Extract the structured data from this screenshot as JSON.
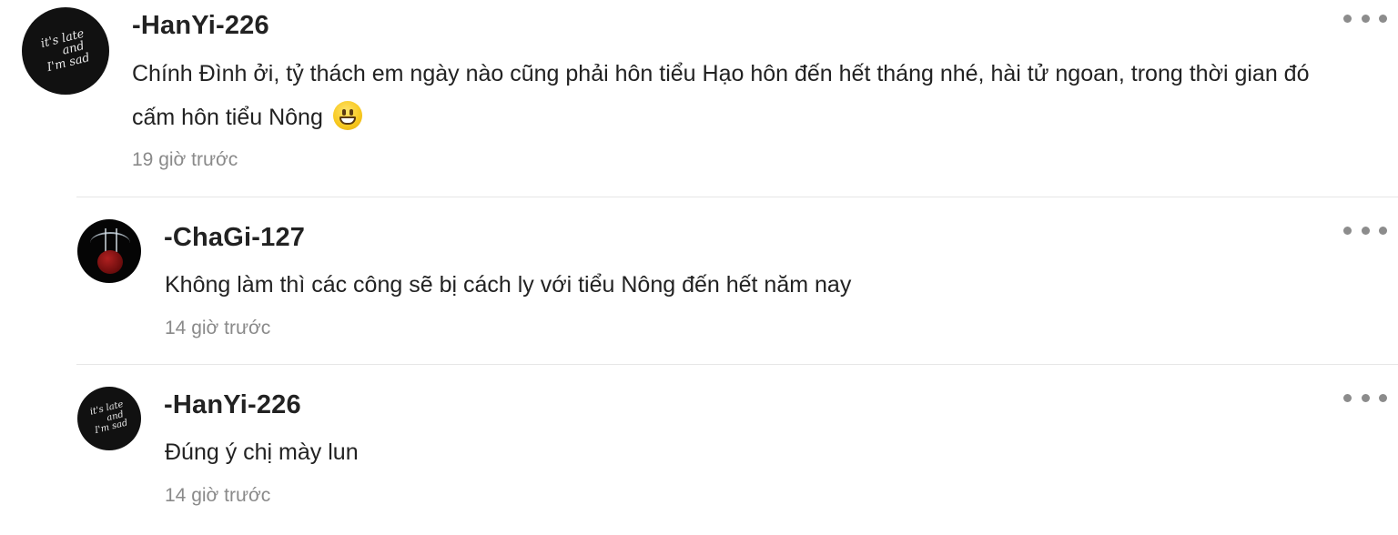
{
  "comments": [
    {
      "username": "-HanYi-226",
      "text_line1": "Chính Đình ởi, tỷ thách em ngày nào cũng phải hôn tiểu Hạo hôn đến hết tháng nhé, hài tử ngoan, trong thời gian đó",
      "text_line2": "cấm hôn tiểu Nông",
      "emoji": "grinning-face-emoji",
      "timestamp": "19 giờ trước",
      "avatar": {
        "lines": [
          "it's late",
          "and",
          "I'm sad"
        ],
        "icon": "chalkboard-avatar"
      }
    },
    {
      "username": "-ChaGi-127",
      "text": "Không làm thì các công sẽ bị cách ly với tiểu Nông đến hết năm nay",
      "timestamp": "14 giờ trước",
      "avatar": {
        "icon": "apple-splash-avatar"
      }
    },
    {
      "username": "-HanYi-226",
      "text": "Đúng ý chị mày lun",
      "timestamp": "14 giờ trước",
      "avatar": {
        "lines": [
          "it's late",
          "and",
          "I'm sad"
        ],
        "icon": "chalkboard-avatar"
      }
    }
  ],
  "more_icon": "more-horizontal-icon",
  "colors": {
    "text": "#222222",
    "muted": "#8a8a8a",
    "divider": "#e6e6e6",
    "dots": "#8c8c8c"
  }
}
